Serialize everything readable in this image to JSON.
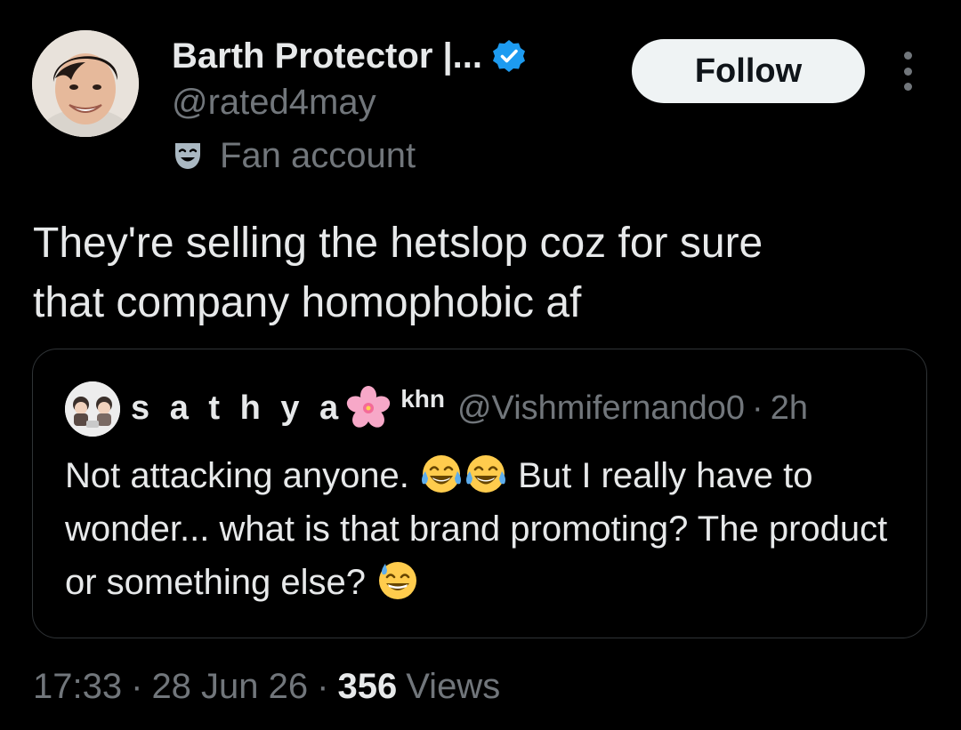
{
  "author": {
    "display_name": "Barth Protector |...",
    "handle": "@rated4may",
    "label": "Fan account",
    "label_icon": "theater-masks-icon",
    "verified": true,
    "verified_color": "#1d9bf0"
  },
  "actions": {
    "follow_label": "Follow",
    "more_icon": "more-dots-icon"
  },
  "tweet": {
    "text": "They're selling the hetslop coz for sure\nthat company homophobic af"
  },
  "quoted_tweet": {
    "display_name": "s a t h y a",
    "name_emoji": "cherry-blossom",
    "name_suffix": "khn",
    "handle": "@Vishmifernando0",
    "separator": "·",
    "time": "2h",
    "text_part1": "Not attacking anyone.",
    "text_emoji_1": "face-with-tears-of-joy",
    "text_emoji_2": "face-with-tears-of-joy",
    "text_part2": "But I really have to wonder... what is that brand promoting? The product or something else?",
    "text_emoji_3": "grinning-face-with-sweat"
  },
  "meta": {
    "time": "17:33",
    "separator": "·",
    "date": "28 Jun 26",
    "views_count": "356",
    "views_label": "Views"
  },
  "colors": {
    "background": "#000000",
    "text_primary": "#e7e9ea",
    "text_secondary": "#71767b",
    "border": "#2f3336",
    "follow_button_bg": "#eff3f4",
    "follow_button_text": "#0f1419",
    "accent_blue": "#1d9bf0"
  }
}
